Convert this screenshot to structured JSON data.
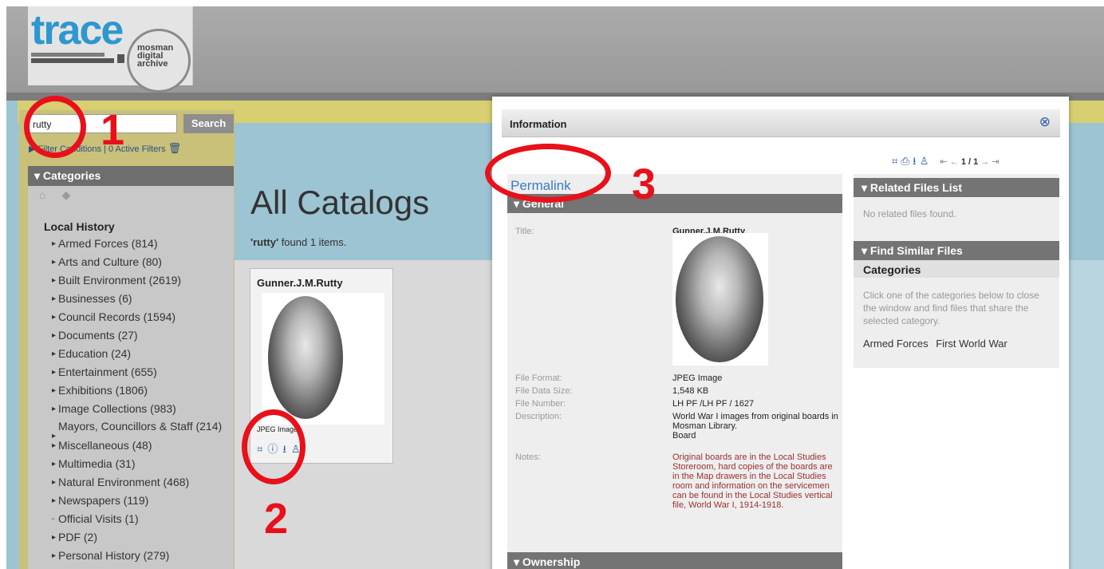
{
  "logo": {
    "word": "trace",
    "sub1": "mosman",
    "sub2": "digital",
    "sub3": "archive"
  },
  "search": {
    "value": "rutty",
    "button": "Search"
  },
  "filters": {
    "label": "Filter Conditions",
    "active": "| 0 Active Filters",
    "trash_icon": "trash-icon"
  },
  "categories": {
    "header": "Categories",
    "section": "Local History",
    "items": [
      {
        "label": "Armed Forces (814)"
      },
      {
        "label": "Arts and Culture (80)"
      },
      {
        "label": "Built Environment (2619)"
      },
      {
        "label": "Businesses (6)"
      },
      {
        "label": "Council Records (1594)"
      },
      {
        "label": "Documents (27)"
      },
      {
        "label": "Education (24)"
      },
      {
        "label": "Entertainment (655)"
      },
      {
        "label": "Exhibitions (1806)"
      },
      {
        "label": "Image Collections (983)"
      },
      {
        "label": "Mayors, Councillors & Staff (214)"
      },
      {
        "label": "Miscellaneous (48)"
      },
      {
        "label": "Multimedia (31)"
      },
      {
        "label": "Natural Environment (468)"
      },
      {
        "label": "Newspapers (119)"
      },
      {
        "label": "Official Visits (1)"
      },
      {
        "label": "PDF (2)"
      },
      {
        "label": "Personal History (279)"
      }
    ]
  },
  "main": {
    "title": "All Catalogs",
    "query": "'rutty'",
    "found_text": " found 1 items."
  },
  "card": {
    "title": "Gunner.J.M.Rutty",
    "format": "JPEG Image",
    "icons": [
      "fit-icon",
      "info-icon",
      "download-icon",
      "basket-icon"
    ]
  },
  "modal": {
    "title": "Information",
    "page": "1 / 1",
    "permalink": "Permalink",
    "general": "General",
    "ownership": "Ownership",
    "fields": {
      "title_label": "Title:",
      "title_value": "Gunner.J.M.Rutty",
      "format_label": "File Format:",
      "format_value": "JPEG Image",
      "size_label": "File Data Size:",
      "size_value": "1,548 KB",
      "number_label": "File Number:",
      "number_value": "LH PF /LH PF / 1627",
      "desc_label": "Description:",
      "desc_value": "World War I images from original boards in Mosman Library.",
      "desc_value2": "Board",
      "notes_label": "Notes:",
      "notes_value": "Original boards are in the Local Studies Storeroom, hard copies of the boards are in the Map drawers in the Local Studies room and information on the servicemen can be found in the Local Studies vertical file, World War I, 1914-1918."
    },
    "related": {
      "header": "Related Files List",
      "empty": "No related files found."
    },
    "similar": {
      "header": "Find Similar Files",
      "sub": "Categories",
      "text": "Click one of the categories below to close the window and find files that share the selected category.",
      "cats": [
        "Armed Forces",
        "First World War"
      ]
    }
  },
  "annotations": {
    "n1": "1",
    "n2": "2",
    "n3": "3"
  },
  "colors": {
    "accent": "#2a5fa8",
    "annotation": "#e8101a",
    "header_bar": "#747474"
  }
}
